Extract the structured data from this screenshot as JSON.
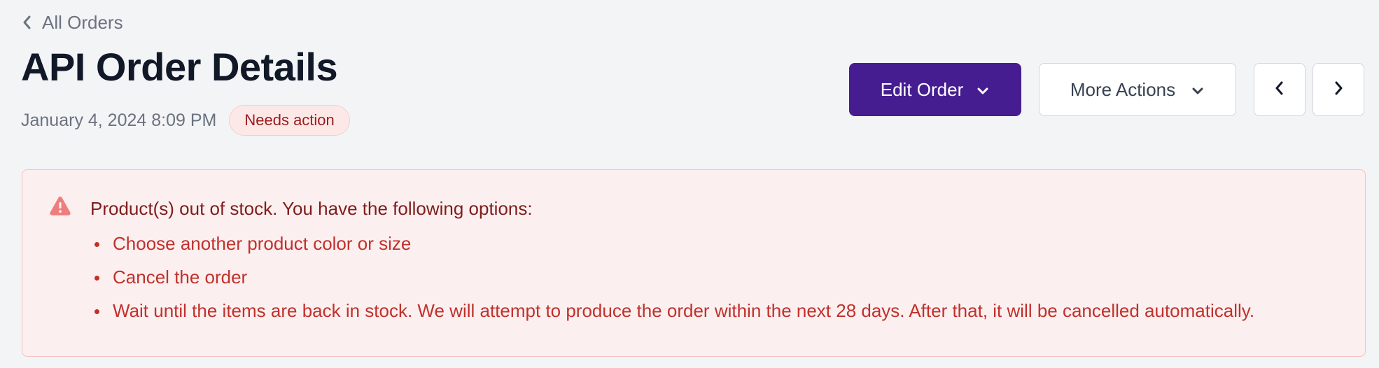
{
  "breadcrumb": {
    "back_label": "All Orders",
    "icon": "chevron-left-icon"
  },
  "header": {
    "title": "API Order Details",
    "date": "January 4, 2024 8:09 PM",
    "status_badge": "Needs action"
  },
  "toolbar": {
    "edit_label": "Edit Order",
    "more_label": "More Actions",
    "prev_icon": "chevron-left-icon",
    "next_icon": "chevron-right-icon"
  },
  "alert": {
    "icon": "warning-triangle-icon",
    "title": "Product(s) out of stock. You have the following options:",
    "options": [
      "Choose another product color or size",
      "Cancel the order",
      "Wait until the items are back in stock. We will attempt to produce the order within the next 28 days. After that, it will be cancelled automatically."
    ]
  },
  "colors": {
    "page_background": "#f3f4f6",
    "primary_button": "#461d91",
    "alert_background": "#fcefef",
    "alert_border": "#f5c2c2",
    "alert_title_text": "#7f1d1d",
    "alert_list_text": "#c0312c",
    "badge_background": "#fde8e8",
    "badge_text": "#9b1c1c"
  }
}
